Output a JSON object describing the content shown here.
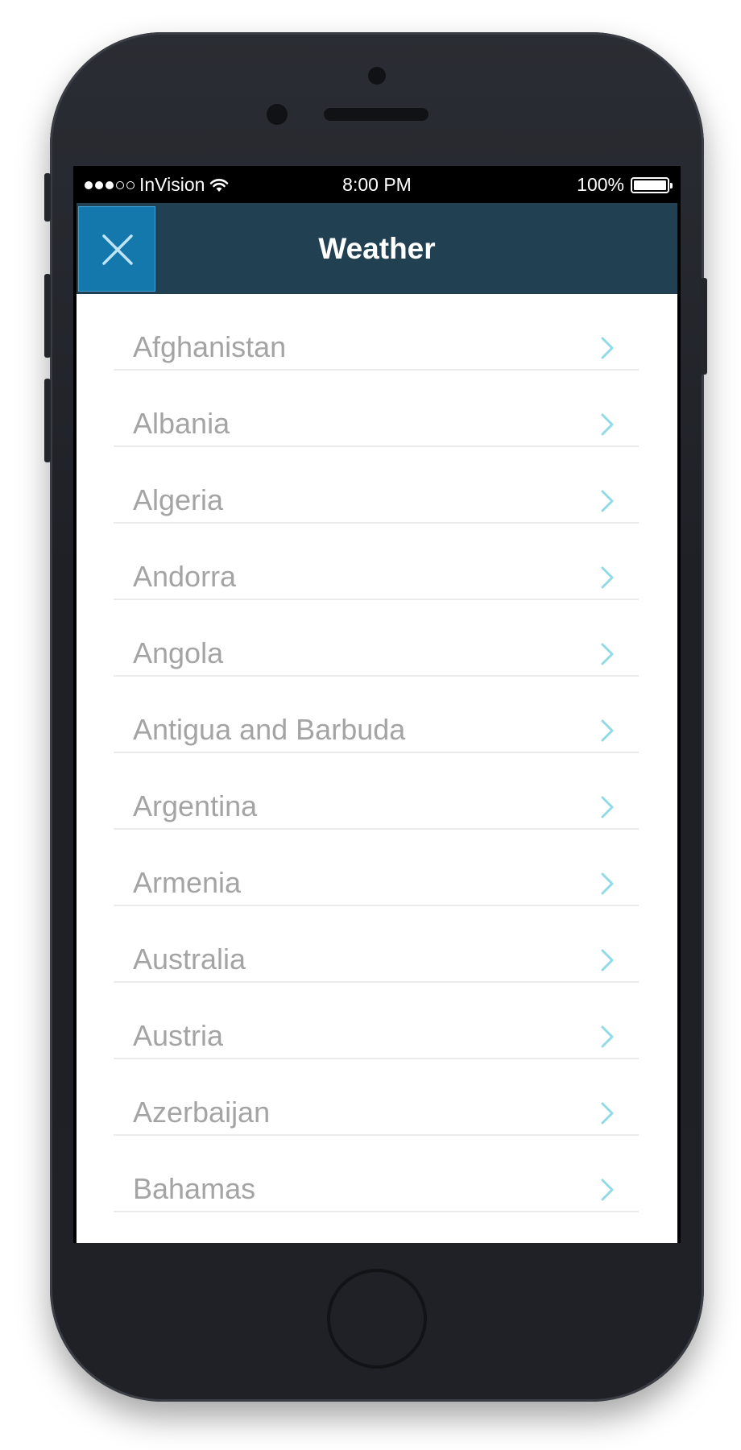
{
  "status_bar": {
    "carrier": "InVision",
    "time": "8:00 PM",
    "battery": "100%",
    "signal_bars": 3,
    "signal_total": 5
  },
  "header": {
    "title": "Weather",
    "close_icon": "close-icon"
  },
  "countries": [
    {
      "label": "Afghanistan"
    },
    {
      "label": "Albania"
    },
    {
      "label": "Algeria"
    },
    {
      "label": "Andorra"
    },
    {
      "label": "Angola"
    },
    {
      "label": "Antigua and Barbuda"
    },
    {
      "label": "Argentina"
    },
    {
      "label": "Armenia"
    },
    {
      "label": "Australia"
    },
    {
      "label": "Austria"
    },
    {
      "label": "Azerbaijan"
    },
    {
      "label": "Bahamas"
    }
  ],
  "colors": {
    "header_bg": "#214152",
    "close_button_bg": "#1478ad",
    "chevron": "#8fdbe6",
    "row_text": "#a4a4a4"
  }
}
